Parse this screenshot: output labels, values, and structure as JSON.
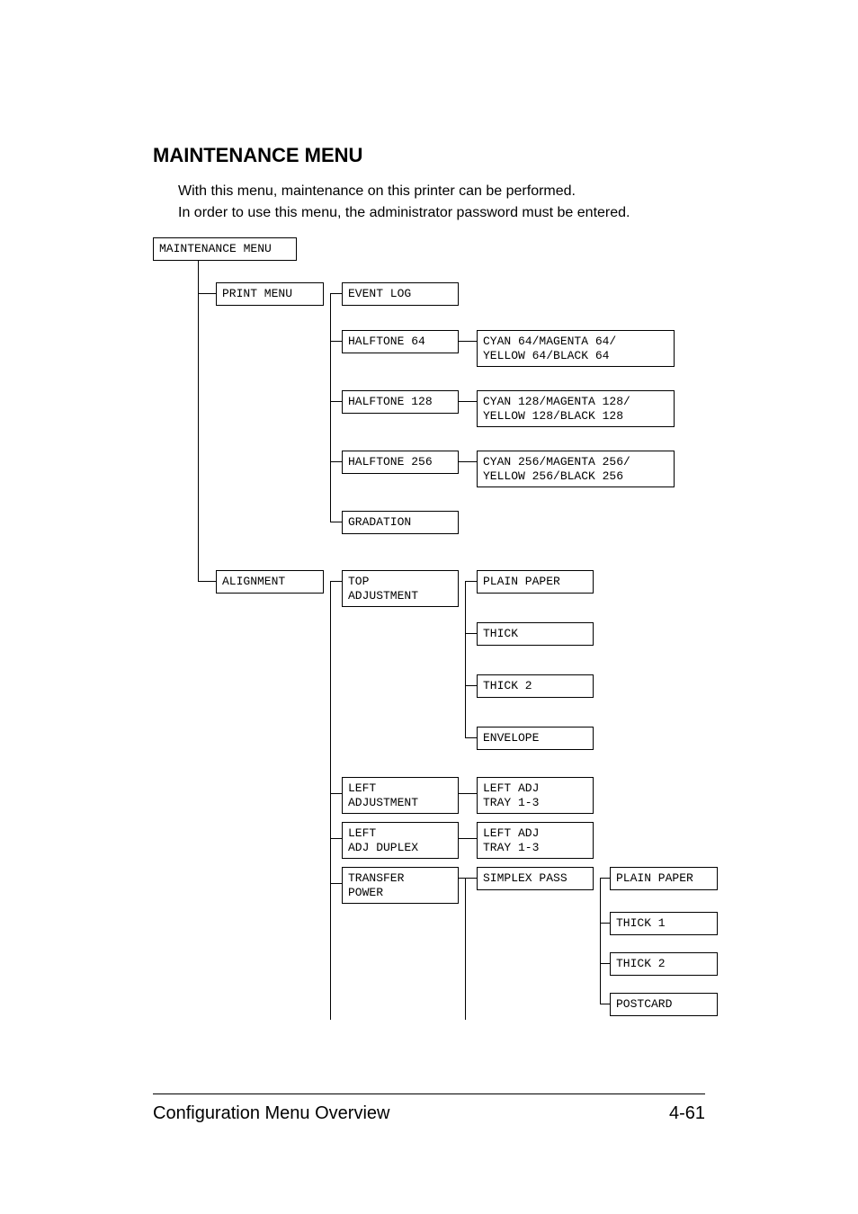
{
  "heading": "MAINTENANCE MENU",
  "intro_lines": [
    "With this menu, maintenance on this printer can be performed.",
    "In order to use this menu, the administrator password must be entered."
  ],
  "diagram": {
    "root": "MAINTENANCE MENU",
    "level1": {
      "print_menu": "PRINT MENU",
      "alignment": "ALIGNMENT"
    },
    "print_menu_children": {
      "event_log": "EVENT LOG",
      "halftone_64": "HALFTONE 64",
      "halftone_128": "HALFTONE 128",
      "halftone_256": "HALFTONE 256",
      "gradation": "GRADATION"
    },
    "halftone_details": {
      "h64": "CYAN 64/MAGENTA 64/\nYELLOW 64/BLACK 64",
      "h128": "CYAN 128/MAGENTA 128/\nYELLOW 128/BLACK 128",
      "h256": "CYAN 256/MAGENTA 256/\nYELLOW 256/BLACK 256"
    },
    "alignment_children": {
      "top_adjustment": "TOP\nADJUSTMENT",
      "left_adjustment": "LEFT\nADJUSTMENT",
      "left_adj_duplex": "LEFT\nADJ DUPLEX",
      "transfer_power": "TRANSFER\nPOWER"
    },
    "top_adjustment_children": {
      "plain_paper": "PLAIN PAPER",
      "thick": "THICK",
      "thick2": "THICK 2",
      "envelope": "ENVELOPE"
    },
    "left_adjustment_child": "LEFT ADJ\nTRAY 1-3",
    "left_adj_duplex_child": "LEFT ADJ\nTRAY 1-3",
    "transfer_power_child": "SIMPLEX PASS",
    "simplex_children": {
      "plain_paper": "PLAIN PAPER",
      "thick1": "THICK 1",
      "thick2": "THICK 2",
      "postcard": "POSTCARD"
    }
  },
  "footer": {
    "left": "Configuration Menu Overview",
    "right": "4-61"
  }
}
